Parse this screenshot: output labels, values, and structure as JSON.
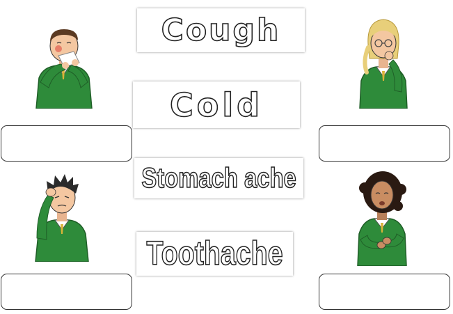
{
  "words": [
    {
      "text": "Cough"
    },
    {
      "text": "Cold"
    },
    {
      "text": "Stomach ache"
    },
    {
      "text": "Toothache"
    }
  ],
  "figures": [
    {
      "icon": "boy-sneezing-with-tissue",
      "ailment_shown": "cold"
    },
    {
      "icon": "girl-coughing",
      "ailment_shown": "cough"
    },
    {
      "icon": "boy-holding-head",
      "ailment_shown": "headache"
    },
    {
      "icon": "girl-holding-stomach",
      "ailment_shown": "stomach ache"
    }
  ],
  "answers": [
    {
      "value": ""
    },
    {
      "value": ""
    },
    {
      "value": ""
    },
    {
      "value": ""
    }
  ],
  "colors": {
    "uniform_green": "#2e8b3a",
    "shirt_white": "#ffffff",
    "tie_gold": "#d9b338",
    "skin": "#f4c7a1",
    "outline": "#222222"
  }
}
